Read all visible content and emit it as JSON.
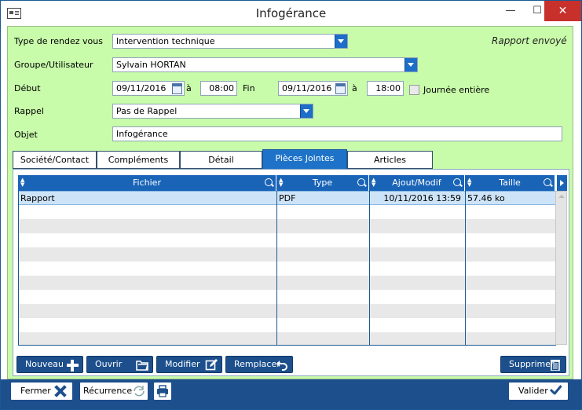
{
  "window": {
    "title": "Infogérance",
    "minimize": "—",
    "maximize": "☐",
    "close": "✕"
  },
  "form": {
    "status": "Rapport envoyé",
    "type_label": "Type de rendez vous",
    "type_value": "Intervention technique",
    "groupe_label": "Groupe/Utilisateur",
    "groupe_value": "Sylvain HORTAN",
    "debut_label": "Début",
    "debut_date": "09/11/2016",
    "a_label_1": "à",
    "debut_time": "08:00",
    "fin_label": "Fin",
    "fin_date": "09/11/2016",
    "a_label_2": "à",
    "fin_time": "18:00",
    "journee_label": "Journée entière",
    "rappel_label": "Rappel",
    "rappel_value": "Pas de Rappel",
    "objet_label": "Objet",
    "objet_value": "Infogérance"
  },
  "tabs": [
    {
      "label": "Société/Contact",
      "active": false
    },
    {
      "label": "Compléments",
      "active": false
    },
    {
      "label": "Détail",
      "active": false
    },
    {
      "label": "Pièces Jointes",
      "active": true
    },
    {
      "label": "Articles",
      "active": false
    }
  ],
  "grid": {
    "columns": [
      "Fichier",
      "Type",
      "Ajout/Modif",
      "Taille"
    ],
    "rows": [
      {
        "fichier": "Rapport",
        "type": "PDF",
        "ajout": "10/11/2016 13:59",
        "taille": "57.46 ko"
      }
    ]
  },
  "panel_buttons": {
    "nouveau": "Nouveau",
    "ouvrir": "Ouvrir",
    "modifier": "Modifier",
    "remplacer": "Remplacer",
    "supprimer": "Supprimer"
  },
  "footer": {
    "fermer": "Fermer",
    "recurrence": "Récurrence",
    "valider": "Valider"
  },
  "colors": {
    "accent": "#1c4f8c",
    "form_background": "#c8fbaa",
    "header_blue": "#1a64b8",
    "close_red": "#c7302b"
  }
}
